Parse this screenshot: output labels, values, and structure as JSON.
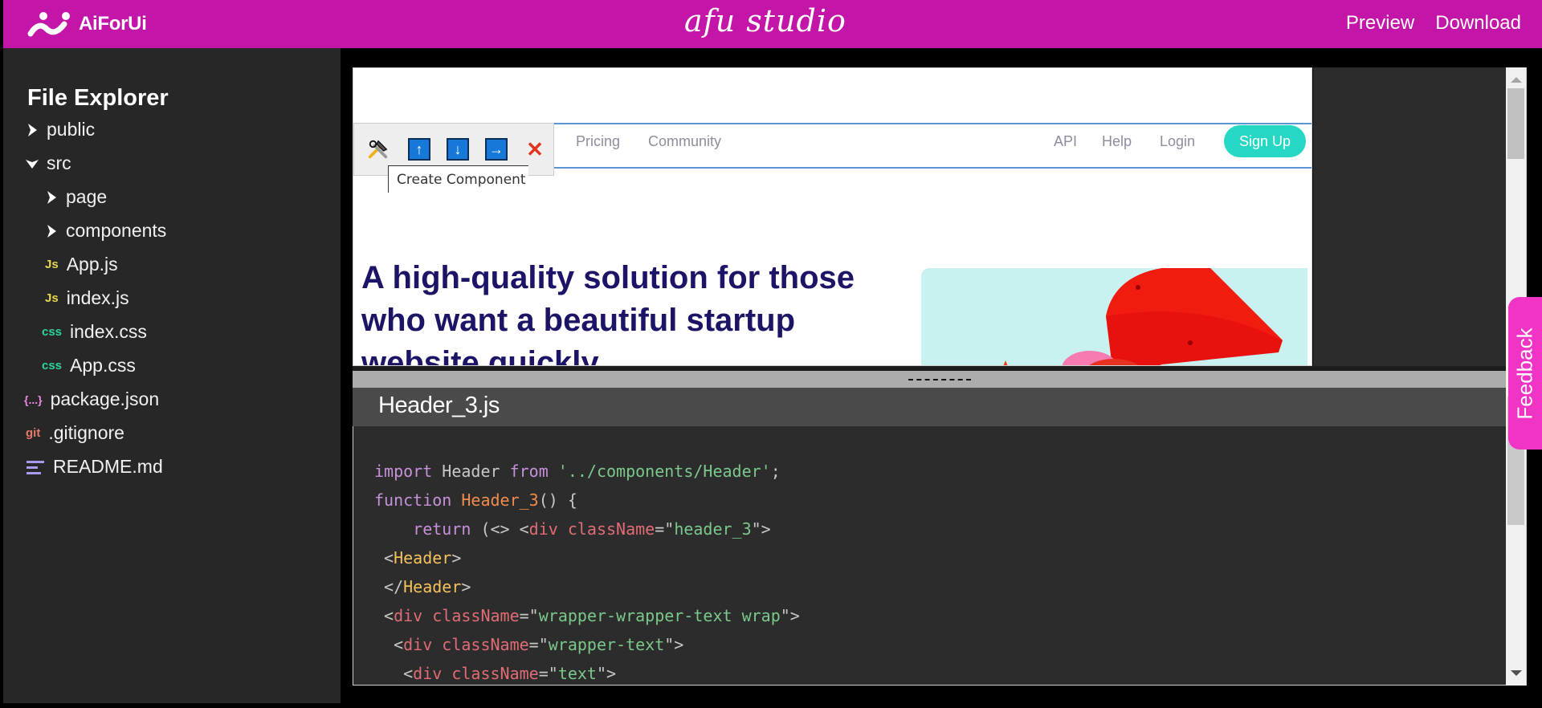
{
  "topbar": {
    "brand_name": "AiForUi",
    "studio_title": "afu studio",
    "actions": [
      "Preview",
      "Download"
    ]
  },
  "sidebar": {
    "title": "File Explorer",
    "items": [
      {
        "label": "public",
        "type": "folder",
        "state": "collapsed",
        "icon": "chevron-right"
      },
      {
        "label": "src",
        "type": "folder",
        "state": "expanded",
        "icon": "chevron-down"
      },
      {
        "label": "page",
        "type": "folder",
        "state": "collapsed",
        "icon": "chevron-right"
      },
      {
        "label": "components",
        "type": "folder",
        "state": "collapsed",
        "icon": "chevron-right"
      },
      {
        "label": "App.js",
        "type": "file",
        "icon": "Js"
      },
      {
        "label": "index.js",
        "type": "file",
        "icon": "Js"
      },
      {
        "label": "index.css",
        "type": "file",
        "icon": "css"
      },
      {
        "label": "App.css",
        "type": "file",
        "icon": "css"
      },
      {
        "label": "package.json",
        "type": "file",
        "icon": "{...}"
      },
      {
        "label": ".gitignore",
        "type": "file",
        "icon": "git"
      },
      {
        "label": "README.md",
        "type": "file",
        "icon": "lines"
      }
    ]
  },
  "preview": {
    "nav_links": [
      "Pricing",
      "Community"
    ],
    "nav_right": [
      "API",
      "Help",
      "Login"
    ],
    "signup_label": "Sign Up",
    "toolbox": {
      "buttons": [
        "tools",
        "↑",
        "↓",
        "→",
        "✕"
      ],
      "tooltip": "Create Component"
    },
    "hero_title": "A high-quality solution for those who want a beautiful startup website quickly."
  },
  "editor": {
    "drag_handle": "-------------",
    "file_name": "Header_3.js",
    "lines": [
      "import Header from '../components/Header';",
      "function Header_3() {",
      "    return (<> <div className=\"header_3\">",
      " <Header>",
      " </Header>",
      " <div className=\"wrapper-wrapper-text wrap\">",
      "  <div className=\"wrapper-text\">",
      "   <div className=\"text\">"
    ]
  },
  "feedback_label": "Feedback",
  "colors": {
    "brand": "#c316a9",
    "accent_signup": "#26d7c4",
    "feedback": "#f035c6",
    "hero_title": "#1b1467"
  }
}
